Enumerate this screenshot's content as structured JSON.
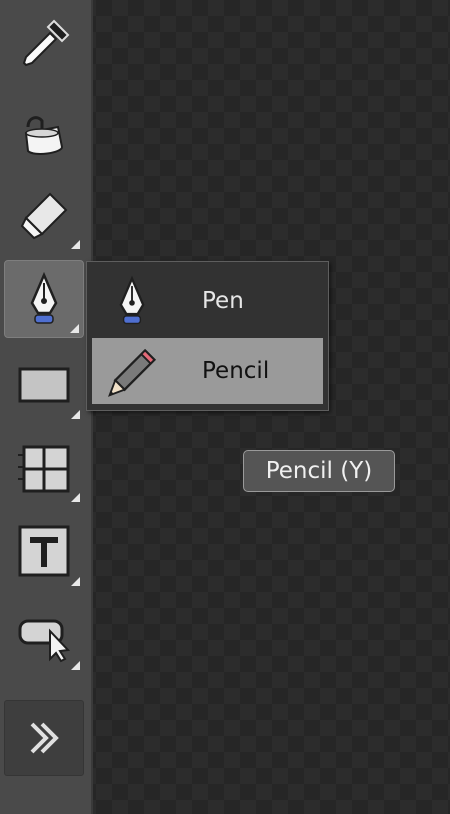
{
  "toolbar": {
    "tools": [
      {
        "name": "eyedropper-icon",
        "has_submenu": false
      },
      {
        "name": "fill-bucket-icon",
        "has_submenu": false
      },
      {
        "name": "eraser-icon",
        "has_submenu": true
      },
      {
        "name": "pen-icon",
        "has_submenu": true,
        "active": true
      },
      {
        "name": "rectangle-icon",
        "has_submenu": true
      },
      {
        "name": "grid-icon",
        "has_submenu": true
      },
      {
        "name": "text-icon",
        "has_submenu": true
      },
      {
        "name": "speech-bubble-cursor-icon",
        "has_submenu": true
      },
      {
        "name": "double-chevron-right-icon",
        "has_submenu": false
      }
    ]
  },
  "flyout": {
    "items": [
      {
        "label": "Pen",
        "icon": "pen-icon",
        "selected": false
      },
      {
        "label": "Pencil",
        "icon": "pencil-icon",
        "selected": true
      }
    ]
  },
  "tooltip": {
    "text": "Pencil (Y)"
  },
  "colors": {
    "toolbar_bg": "#4a4a4a",
    "canvas_bg": "#262626",
    "active_tool_bg": "#6b6b6b",
    "selected_item_bg": "#9a9a9a",
    "pen_nib_blue": "#4f6fd0",
    "pencil_eraser_pink": "#e46a78"
  }
}
